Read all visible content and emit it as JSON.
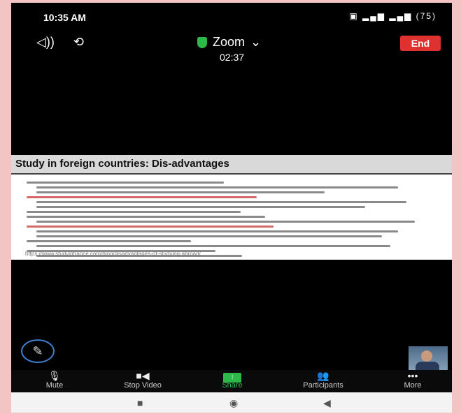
{
  "status": {
    "time": "10:35 AM",
    "icons": "▣ ▂▄▆ ▂▄▆ (75)"
  },
  "header": {
    "speaker_icon": "speaker-icon",
    "camera_switch_icon": "camera-switch-icon",
    "meeting_name": "Zoom",
    "timer": "02:37",
    "end_label": "End"
  },
  "slide": {
    "title": "Study in foreign countries: Dis-advantages",
    "url": "https://www.studyinfrance.com/blog/disadvantages-of-studying-abroad/"
  },
  "toolbar": {
    "items": [
      {
        "icon": "microphone-icon",
        "label": "Mute"
      },
      {
        "icon": "video-camera-icon",
        "label": "Stop Video"
      },
      {
        "icon": "share-icon",
        "label": "Share"
      },
      {
        "icon": "participants-icon",
        "label": "Participants"
      },
      {
        "icon": "more-icon",
        "label": "More"
      }
    ]
  },
  "colors": {
    "end": "#e03131",
    "share": "#2fb84a",
    "annotate_ring": "#3f7fcf"
  }
}
